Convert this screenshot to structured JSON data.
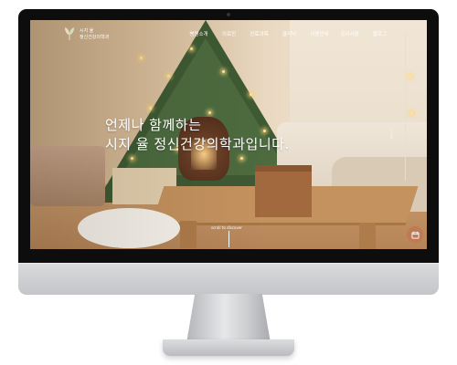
{
  "site": {
    "logo": {
      "line1": "시지 율",
      "line2": "정신건강의학과"
    },
    "nav": {
      "items": [
        "병원소개",
        "의료진",
        "진료과목",
        "클리닉",
        "이용안내",
        "공지사항",
        "블로그"
      ]
    },
    "hero": {
      "line1": "언제나 함께하는",
      "line2": "시지 율 정신건강의학과입니다."
    },
    "scroll_label": "scroll to discover",
    "side_label": "scroll",
    "fab_icon": "calendar-icon"
  },
  "colors": {
    "accent": "#c07a53",
    "text_on_image": "#ffffff",
    "bezel": "#0d0d0d"
  }
}
